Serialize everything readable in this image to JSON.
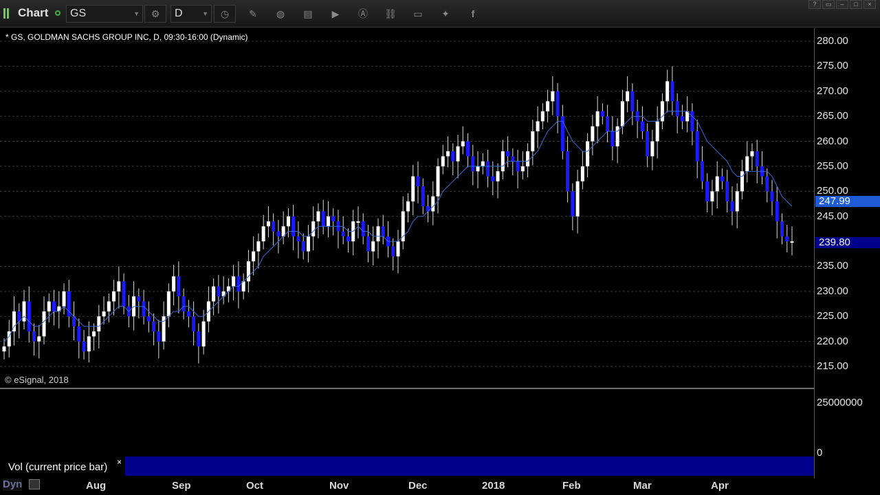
{
  "toolbar": {
    "title": "Chart",
    "symbol": "GS",
    "interval": "D"
  },
  "chart": {
    "header": "* GS, GOLDMAN SACHS GROUP INC, D, 09:30-16:00 (Dynamic)",
    "copyright": "© eSignal, 2018",
    "last_price_label": "239.80",
    "ma_value_label": "247.99",
    "colors": {
      "up_candle": "#ffffff",
      "down_candle": "#1a1aff",
      "ma_line": "#3d6cd6",
      "last_price_bg": "#00008c",
      "ma_tag_bg": "#1e5bd6"
    }
  },
  "volume": {
    "label": "Vol (current price bar)",
    "close": "×",
    "axis_labels": [
      "25000000",
      "0"
    ]
  },
  "footer": {
    "tab_label": "Dyn"
  },
  "chart_data": {
    "type": "candlestick",
    "title": "* GS, GOLDMAN SACHS GROUP INC, D, 09:30-16:00 (Dynamic)",
    "y_ticks": [
      "280.00",
      "275.00",
      "270.00",
      "265.00",
      "260.00",
      "255.00",
      "250.00",
      "245.00",
      "235.00",
      "230.00",
      "225.00",
      "220.00",
      "215.00"
    ],
    "x_ticks": [
      "Aug",
      "Sep",
      "Oct",
      "Nov",
      "Dec",
      "2018",
      "Feb",
      "Mar",
      "Apr"
    ],
    "ylim": [
      211,
      283
    ],
    "series": [
      {
        "type": "close",
        "values": [
          219,
          222,
          226,
          224,
          228,
          222,
          220,
          221,
          226,
          228,
          226,
          227,
          230,
          225,
          223,
          220,
          218,
          221,
          222,
          225,
          226,
          228,
          230,
          232,
          227,
          225,
          229,
          228,
          225,
          224,
          222,
          220,
          225,
          230,
          233,
          229,
          226,
          225,
          222,
          219,
          224,
          228,
          231,
          229,
          230,
          231,
          233,
          230,
          232,
          236,
          238,
          240,
          243,
          244,
          242,
          241,
          243,
          245,
          241,
          240,
          238,
          241,
          244,
          246,
          243,
          245,
          244,
          242,
          241,
          240,
          244,
          244,
          241,
          238,
          240,
          243,
          241,
          239,
          237,
          240,
          246,
          248,
          253,
          251,
          247,
          246,
          249,
          255,
          257,
          258,
          256,
          259,
          260,
          257,
          254,
          255,
          256,
          253,
          252,
          254,
          258,
          257,
          256,
          254,
          255,
          258,
          262,
          264,
          266,
          268,
          270,
          265,
          258,
          250,
          245,
          252,
          255,
          260,
          263,
          266,
          265,
          262,
          259,
          263,
          268,
          270,
          266,
          264,
          262,
          257,
          260,
          264,
          268,
          272,
          268,
          265,
          264,
          266,
          262,
          256,
          252,
          248,
          250,
          253,
          252,
          248,
          246,
          250,
          254,
          257,
          258,
          255,
          253,
          250,
          248,
          244,
          241,
          240,
          240
        ],
        "name": ""
      },
      {
        "type": "ma",
        "values": [
          220,
          221,
          223,
          224,
          225,
          224,
          223,
          223,
          224,
          225,
          226,
          226,
          227,
          226,
          225,
          224,
          223,
          223,
          223,
          223,
          224,
          225,
          226,
          227,
          227,
          226,
          227,
          227,
          227,
          226,
          225,
          224,
          224,
          225,
          226,
          226,
          227,
          227,
          226,
          225,
          225,
          226,
          227,
          228,
          229,
          230,
          231,
          231,
          232,
          233,
          234,
          235,
          237,
          238,
          239,
          240,
          241,
          242,
          242,
          242,
          241,
          241,
          242,
          243,
          243,
          243,
          243,
          243,
          243,
          242,
          242,
          243,
          242,
          242,
          241,
          241,
          241,
          240,
          240,
          240,
          241,
          242,
          244,
          245,
          245,
          246,
          247,
          248,
          250,
          251,
          252,
          253,
          254,
          255,
          255,
          255,
          255,
          255,
          255,
          255,
          255,
          256,
          256,
          256,
          256,
          256,
          257,
          258,
          260,
          262,
          263,
          264,
          264,
          262,
          260,
          259,
          258,
          258,
          259,
          260,
          261,
          262,
          262,
          262,
          263,
          264,
          265,
          265,
          265,
          264,
          264,
          264,
          265,
          266,
          266,
          266,
          266,
          266,
          265,
          264,
          262,
          260,
          259,
          258,
          257,
          256,
          254,
          253,
          253,
          254,
          254,
          254,
          254,
          254,
          253,
          251,
          249,
          248,
          247
        ],
        "name": ""
      }
    ]
  }
}
